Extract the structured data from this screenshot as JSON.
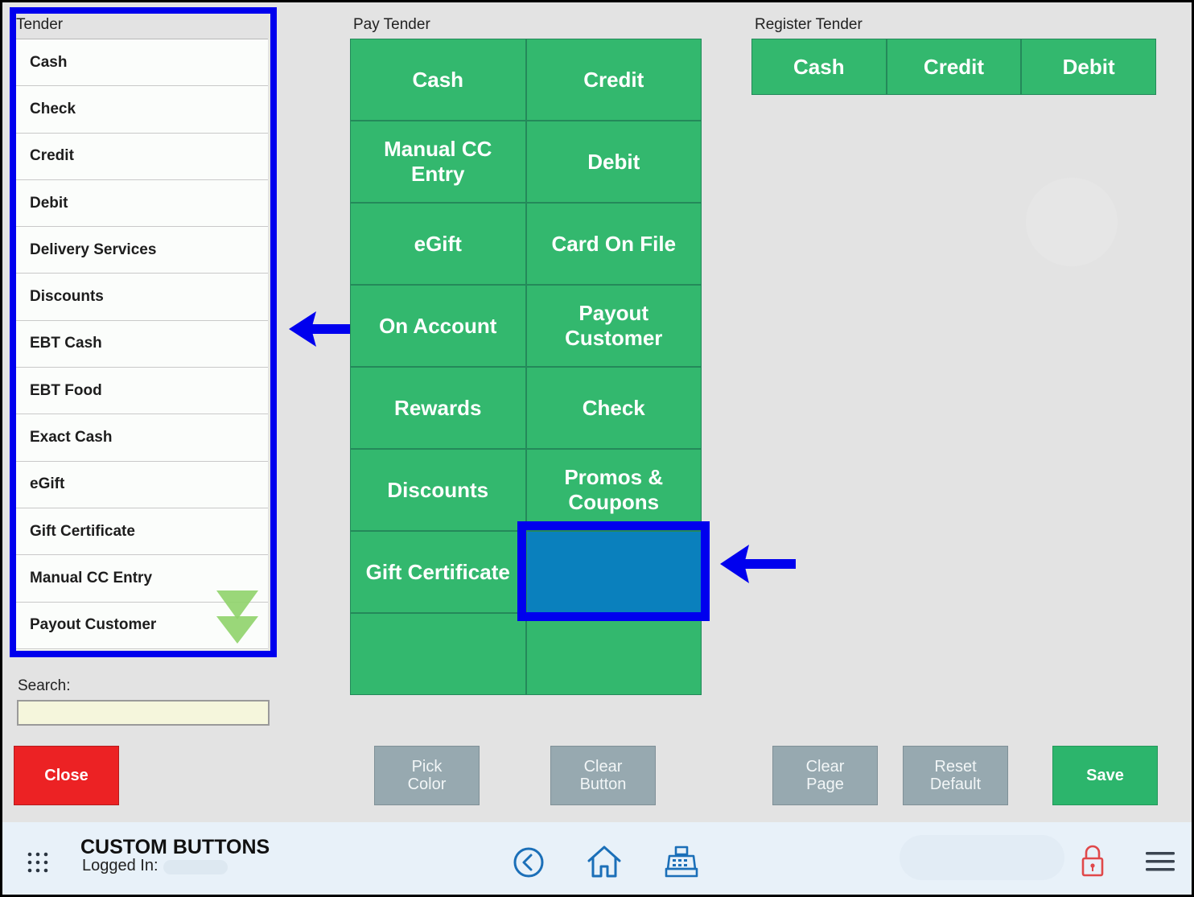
{
  "tender": {
    "label": "Tender",
    "items": [
      "Cash",
      "Check",
      "Credit",
      "Debit",
      "Delivery Services",
      "Discounts",
      "EBT Cash",
      "EBT Food",
      "Exact Cash",
      "eGift",
      "Gift Certificate",
      "Manual CC Entry",
      "Payout Customer"
    ]
  },
  "search": {
    "label": "Search:",
    "value": "",
    "placeholder": ""
  },
  "pay_tender": {
    "label": "Pay Tender",
    "cells": [
      "Cash",
      "Credit",
      "Manual CC Entry",
      "Debit",
      "eGift",
      "Card On File",
      "On Account",
      "Payout Customer",
      "Rewards",
      "Check",
      "Discounts",
      "Promos & Coupons",
      "Gift Certificate",
      "",
      "",
      ""
    ]
  },
  "register_tender": {
    "label": "Register Tender",
    "cells": [
      "Cash",
      "Credit",
      "Debit"
    ]
  },
  "actions": {
    "close": "Close",
    "pick_color": "Pick\nColor",
    "clear_button": "Clear\nButton",
    "clear_page": "Clear\nPage",
    "reset_default": "Reset\nDefault",
    "save": "Save"
  },
  "footer": {
    "title": "CUSTOM BUTTONS",
    "logged_in_label": "Logged In:"
  },
  "icons": {
    "apps": "apps-grid-icon",
    "back": "back-circle-icon",
    "home": "home-icon",
    "register": "cash-register-icon",
    "lock": "lock-icon",
    "menu": "hamburger-menu-icon",
    "scroll": "scroll-down-icon"
  },
  "colors": {
    "tender_green": "#33b86e",
    "selected_blue": "#0a80bd",
    "highlight_blue": "#0000ee",
    "close_red": "#ec2224",
    "gray_button": "#97a9b0"
  }
}
